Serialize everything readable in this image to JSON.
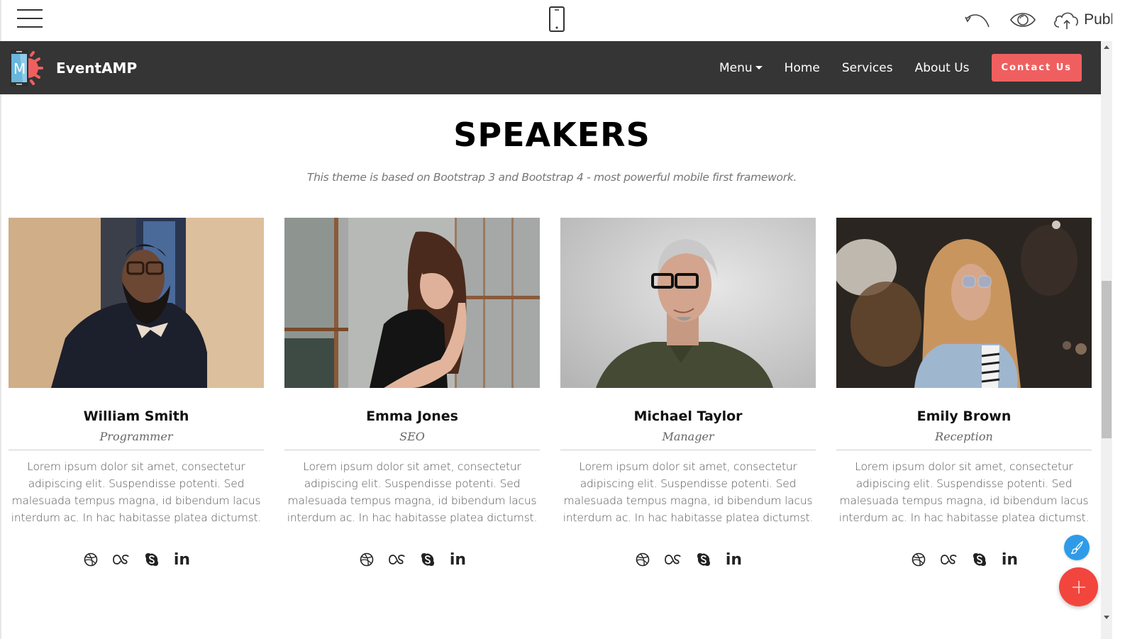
{
  "builder_toolbar": {
    "menu_icon": "hamburger-icon",
    "device_icon": "mobile-phone-icon",
    "undo_icon": "undo-icon",
    "preview_icon": "eye-icon",
    "publish_icon": "cloud-upload-icon",
    "publish_label": "Publish"
  },
  "site_nav": {
    "brand_name": "EventAMP",
    "logo_letter": "M",
    "links": [
      {
        "label": "Menu",
        "has_dropdown": true
      },
      {
        "label": "Home"
      },
      {
        "label": "Services"
      },
      {
        "label": "About Us"
      }
    ],
    "cta_label": "Contact Us",
    "colors": {
      "nav_bg": "#353535",
      "cta": "#f05f60"
    }
  },
  "section": {
    "title": "SPEAKERS",
    "subtitle": "This theme is based on Bootstrap 3 and Bootstrap 4 - most powerful mobile first framework."
  },
  "speakers": [
    {
      "name": "William Smith",
      "role": "Programmer",
      "bio": "Lorem ipsum dolor sit amet, consectetur adipiscing elit. Suspendisse potenti. Sed malesuada tempus magna, id bibendum lacus interdum ac. In hac habitasse platea dictumst.",
      "photo_alt": "bearded man with glasses and bow tie"
    },
    {
      "name": "Emma Jones",
      "role": "SEO",
      "bio": "Lorem ipsum dolor sit amet, consectetur adipiscing elit. Suspendisse potenti. Sed malesuada tempus magna, id bibendum lacus interdum ac. In hac habitasse platea dictumst.",
      "photo_alt": "woman with long brown hair by window"
    },
    {
      "name": "Michael Taylor",
      "role": "Manager",
      "bio": "Lorem ipsum dolor sit amet, consectetur adipiscing elit. Suspendisse potenti. Sed malesuada tempus magna, id bibendum lacus interdum ac. In hac habitasse platea dictumst.",
      "photo_alt": "grey-haired man with glasses in green polo"
    },
    {
      "name": "Emily Brown",
      "role": "Reception",
      "bio": "Lorem ipsum dolor sit amet, consectetur adipiscing elit. Suspendisse potenti. Sed malesuada tempus magna, id bibendum lacus interdum ac. In hac habitasse platea dictumst.",
      "photo_alt": "blonde woman in denim jacket with sunglasses"
    }
  ],
  "social_icons": [
    "dribbble-icon",
    "lastfm-icon",
    "skype-icon",
    "linkedin-icon"
  ],
  "social_linkedin_text": "in",
  "floating": {
    "brush_icon": "paint-brush-icon",
    "add_icon": "plus-icon",
    "brush_color": "#2f9be8",
    "add_color": "#f2453d"
  }
}
